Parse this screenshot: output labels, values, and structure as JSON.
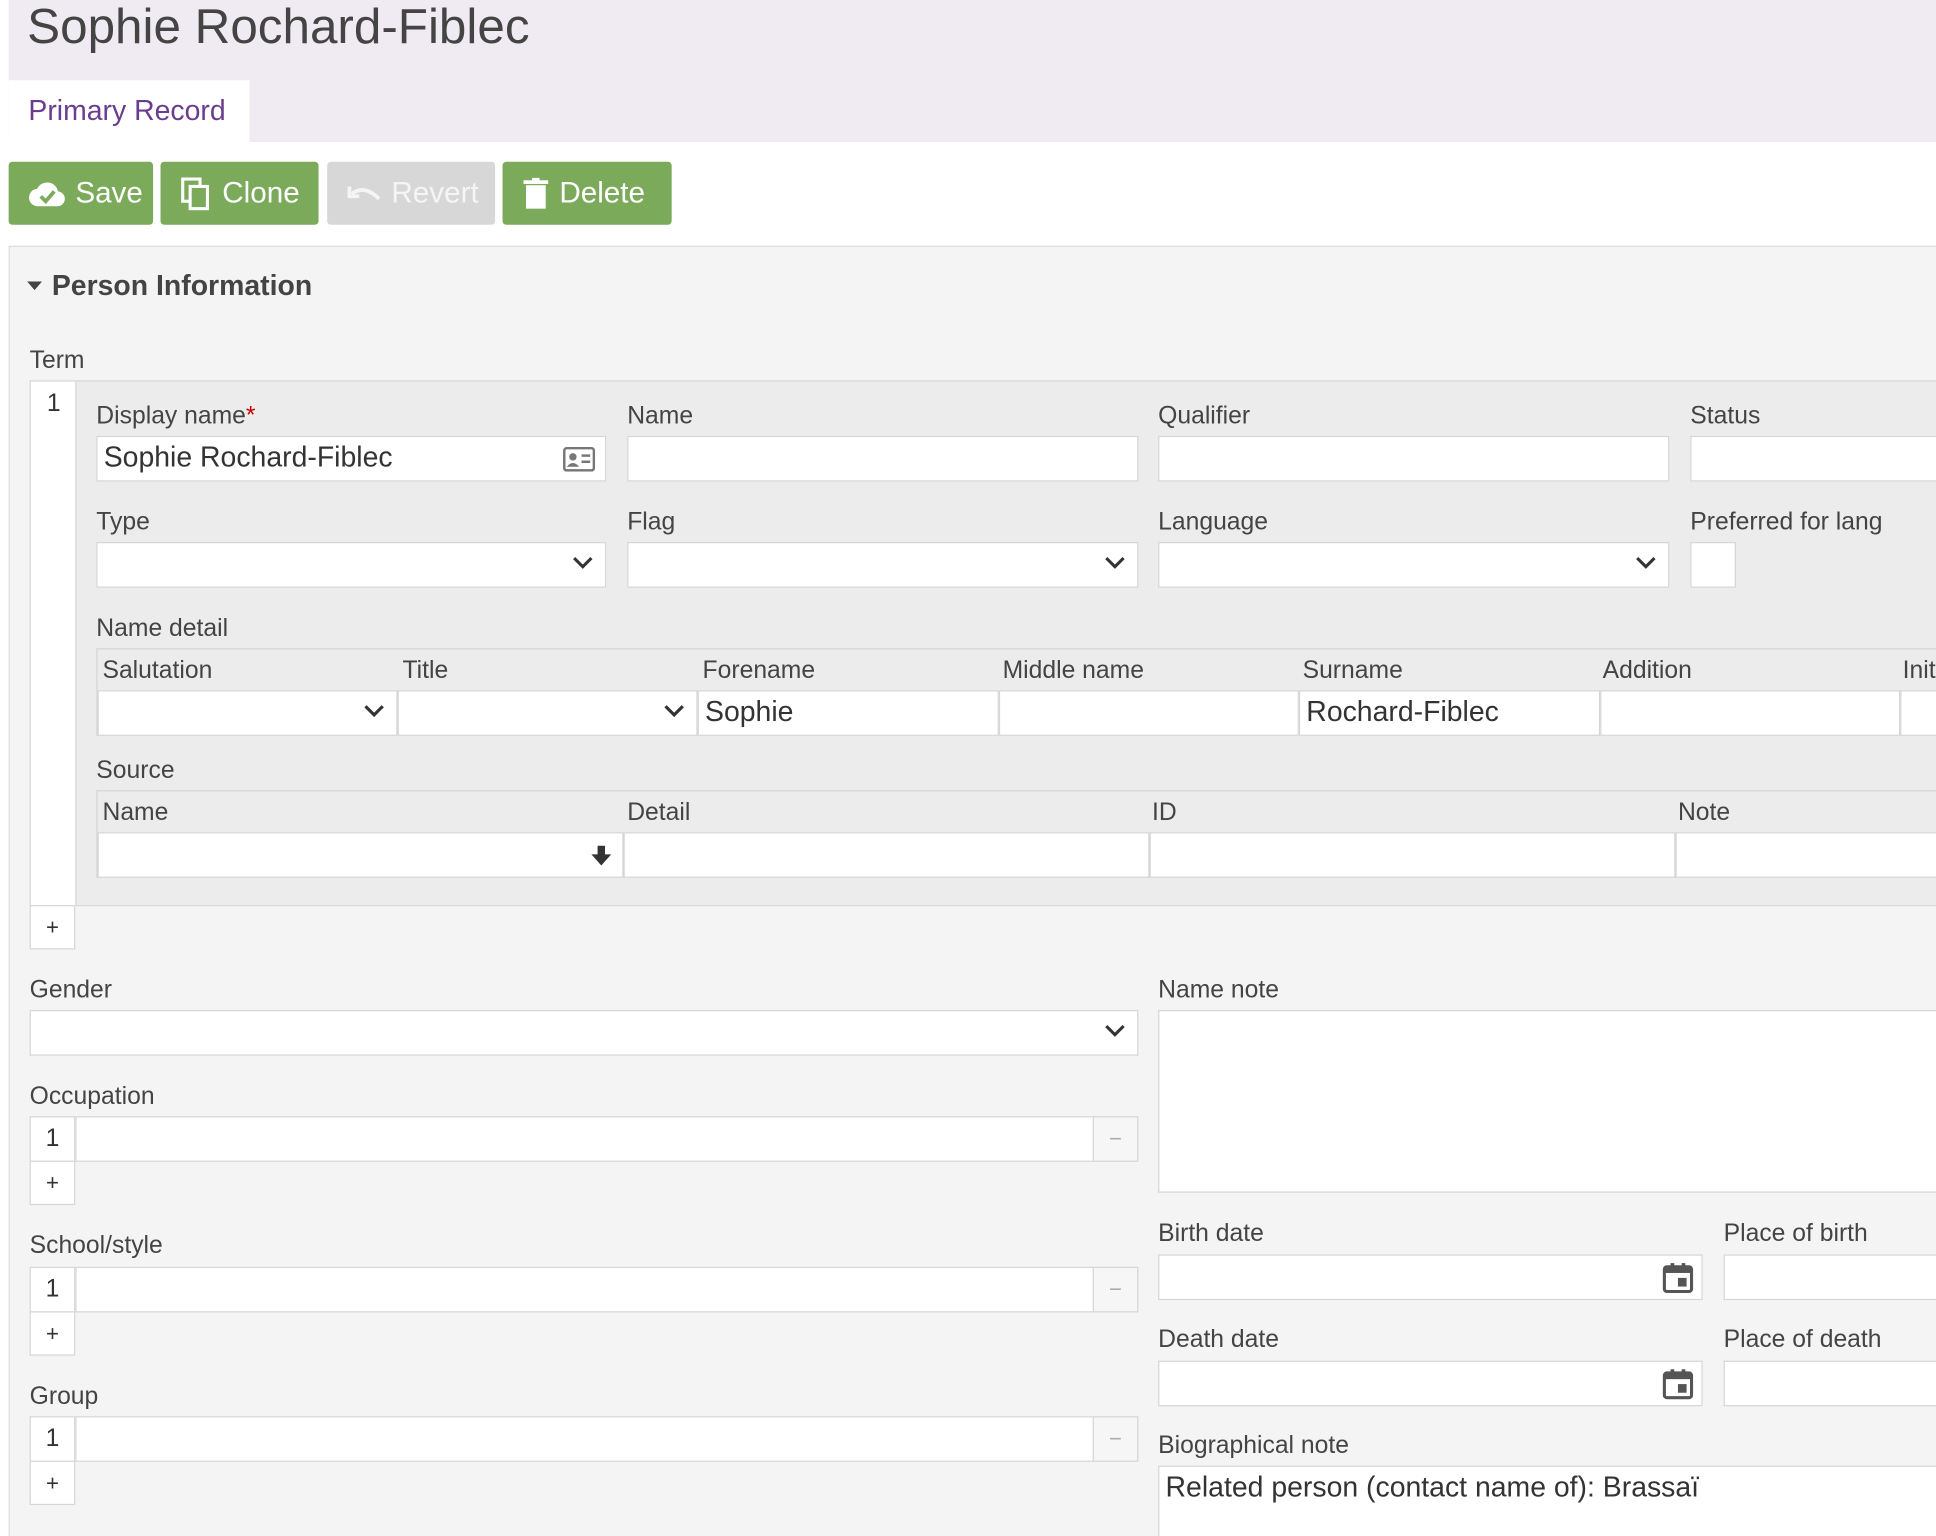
{
  "page": {
    "title": "Sophie Rochard-Fiblec"
  },
  "tabs": [
    {
      "label": "Primary Record"
    }
  ],
  "toolbar": {
    "save_label": "Save",
    "clone_label": "Clone",
    "revert_label": "Revert",
    "delete_label": "Delete",
    "colors": {
      "primary": "#7aaa5a",
      "disabled": "#d7d7d7"
    }
  },
  "section": {
    "title": "Person Information"
  },
  "term": {
    "label": "Term",
    "index": "1",
    "display_name": {
      "label": "Display name",
      "required_mark": "*",
      "value": "Sophie Rochard-Fiblec"
    },
    "name": {
      "label": "Name",
      "value": ""
    },
    "qualifier": {
      "label": "Qualifier",
      "value": ""
    },
    "status": {
      "label": "Status",
      "value": ""
    },
    "type": {
      "label": "Type",
      "value": ""
    },
    "flag": {
      "label": "Flag",
      "value": ""
    },
    "language": {
      "label": "Language",
      "value": ""
    },
    "preferred": {
      "label": "Preferred for lang"
    },
    "name_detail": {
      "label": "Name detail",
      "columns": [
        "Salutation",
        "Title",
        "Forename",
        "Middle name",
        "Surname",
        "Addition",
        "Init"
      ],
      "row": {
        "salutation": "",
        "title": "",
        "forename": "Sophie",
        "middle": "",
        "surname": "Rochard-Fiblec",
        "addition": ""
      }
    },
    "source": {
      "label": "Source",
      "columns": [
        "Name",
        "Detail",
        "ID",
        "Note"
      ]
    },
    "add_label": "+"
  },
  "gender": {
    "label": "Gender",
    "value": ""
  },
  "occupation": {
    "label": "Occupation",
    "index": "1",
    "add_label": "+",
    "remove_label": "−"
  },
  "school_style": {
    "label": "School/style",
    "index": "1",
    "add_label": "+",
    "remove_label": "−"
  },
  "group": {
    "label": "Group",
    "index": "1",
    "add_label": "+",
    "remove_label": "−"
  },
  "name_note": {
    "label": "Name note",
    "value": ""
  },
  "birth_date": {
    "label": "Birth date"
  },
  "place_of_birth": {
    "label": "Place of birth"
  },
  "death_date": {
    "label": "Death date"
  },
  "place_of_death": {
    "label": "Place of death"
  },
  "bio_note": {
    "label": "Biographical note",
    "value": "Related person (contact name of): Brassaï"
  }
}
